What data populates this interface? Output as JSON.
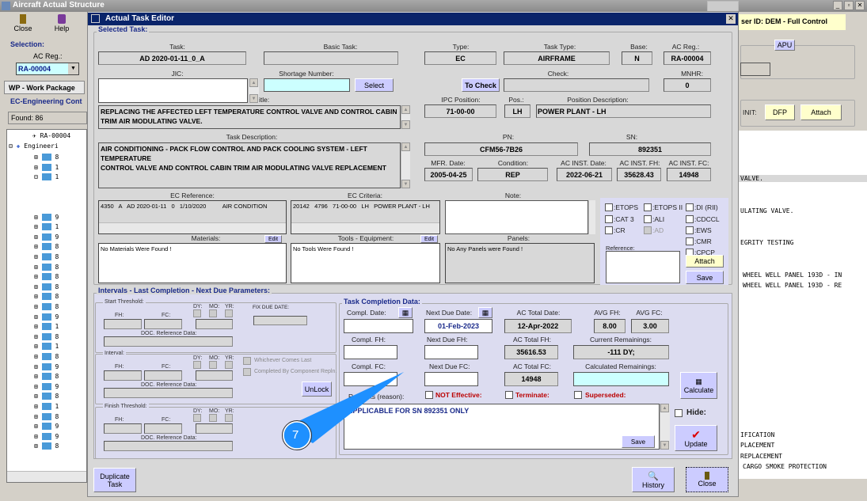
{
  "app": {
    "title": "Aircraft Actual Structure",
    "toolbar": {
      "close": "Close",
      "help": "Help"
    },
    "selection_label": "Selection:",
    "ac_reg_label": "AC Reg.:",
    "ac_reg_value": "RA-00004",
    "wp_tab": "WP - Work Package",
    "ec_section": "EC-Engineering Cont",
    "found": "Found: 86",
    "tree": {
      "root": "RA-00004",
      "engineering": "Engineeri",
      "items": [
        "8",
        "1",
        "1",
        "9",
        "1",
        "9",
        "8",
        "8",
        "8",
        "8",
        "8",
        "8",
        "8",
        "9",
        "1",
        "8",
        "1",
        "8",
        "9",
        "8",
        "9",
        "8",
        "1",
        "8",
        "9",
        "9",
        "8"
      ]
    },
    "user_id": "ser ID: DEM - Full Control",
    "apu": "APU",
    "init_label": "INIT:",
    "dfp": "DFP",
    "attach": "Attach",
    "right_lines": [
      "VALVE.",
      "ULATING VALVE.",
      "EGRITY TESTING",
      "WHEEL WELL PANEL 193D - IN",
      "WHEEL WELL PANEL 193D - RE",
      "IFICATION",
      "PLACEMENT",
      "REPLACEMENT",
      "CARGO SMOKE PROTECTION"
    ]
  },
  "dialog": {
    "title": "Actual Task Editor",
    "selected": {
      "section": "Selected Task:",
      "task_label": "Task:",
      "task": "AD 2020-01-11_0_A",
      "basic_task_label": "Basic Task:",
      "basic_task": "",
      "type_label": "Type:",
      "type": "EC",
      "task_type_label": "Task Type:",
      "task_type": "AIRFRAME",
      "base_label": "Base:",
      "base": "N",
      "ac_reg_label": "AC Reg.:",
      "ac_reg": "RA-00004",
      "jic_label": "JIC:",
      "shortage_label": "Shortage Number:",
      "select": "Select",
      "to_check": "To Check",
      "check_label": "Check:",
      "mnhr_label": "MNHR:",
      "mnhr": "0",
      "title_label": "itle:",
      "title": "REPLACING THE AFFECTED LEFT TEMPERATURE CONTROL VALVE AND CONTROL CABIN TRIM AIR MODULATING VALVE.",
      "ipc_label": "IPC Position:",
      "ipc": "71-00-00",
      "pos_label": "Pos.:",
      "pos": "LH",
      "posdesc_label": "Position Description:",
      "posdesc": "POWER PLANT - LH",
      "desc_label": "Task Description:",
      "desc": "AIR CONDITIONING - PACK FLOW CONTROL AND PACK COOLING SYSTEM - LEFT TEMPERATURE\nCONTROL VALVE AND CONTROL CABIN TRIM AIR MODULATING VALVE REPLACEMENT",
      "pn_label": "PN:",
      "pn": "CFM56-7B26",
      "sn_label": "SN:",
      "sn": "892351",
      "mfr_label": "MFR. Date:",
      "mfr": "2005-04-25",
      "cond_label": "Condition:",
      "cond": "REP",
      "inst_date_label": "AC INST. Date:",
      "inst_date": "2022-06-21",
      "inst_fh_label": "AC INST. FH:",
      "inst_fh": "35628.43",
      "inst_fc_label": "AC INST. FC:",
      "inst_fc": "14948",
      "ec_ref_label": "EC Reference:",
      "ec_ref": "4350   A   AD 2020-01-11   0   1/10/2020          AIR CONDITION",
      "ec_crit_label": "EC Criteria:",
      "ec_crit": "20142   4796   71-00-00   LH   POWER PLANT - LH",
      "note_label": "Note:",
      "materials_label": "Materials:",
      "materials": "No Materials Were Found !",
      "edit": "Edit",
      "tools_label": "Tools - Equipment:",
      "tools": "No Tools Were Found !",
      "panels_label": "Panels:",
      "panels": "No Any Panels were Found !",
      "flags": {
        "etops": ":ETOPS",
        "etops2": ":ETOPS II",
        "di": ":DI (RII)",
        "cat3": ":CAT 3",
        "ali": ":ALI",
        "cdccl": ":CDCCL",
        "cr": ":CR",
        "ad": ":AD",
        "ews": ":EWS",
        "cmr": ":CMR",
        "cpcp": ":CPCP"
      },
      "reference_label": "Reference:",
      "attach": "Attach",
      "save": "Save"
    },
    "intervals": {
      "section": "Intervals - Last Completion - Next Due Parameters:",
      "start": "Start Threshold:",
      "interval": "Interval:",
      "finish": "Finish Threshold:",
      "fh": "FH:",
      "fc": "FC:",
      "dy": "DY:",
      "mo": "MO:",
      "yr": "YR:",
      "doc": "DOC. Reference Data:",
      "fix_due": "FIX DUE DATE:",
      "whichever": "Whichever Comes Last",
      "completed_by": "Completed By Component Repln.",
      "unlock": "UnLock"
    },
    "completion": {
      "section": "Task Completion Data:",
      "compl_date_label": "Compl. Date:",
      "next_due_date_label": "Next Due Date:",
      "next_due_date": "01-Feb-2023",
      "ac_total_date_label": "AC Total Date:",
      "ac_total_date": "12-Apr-2022",
      "avg_fh_label": "AVG FH:",
      "avg_fh": "8.00",
      "avg_fc_label": "AVG FC:",
      "avg_fc": "3.00",
      "compl_fh_label": "Compl. FH:",
      "next_due_fh_label": "Next Due FH:",
      "ac_total_fh_label": "AC Total FH:",
      "ac_total_fh": "35616.53",
      "current_rem_label": "Current Remainings:",
      "current_rem": "-111 DY;",
      "compl_fc_label": "Compl. FC:",
      "next_due_fc_label": "Next Due FC:",
      "ac_total_fc_label": "AC Total FC:",
      "ac_total_fc": "14948",
      "calc_rem_label": "Calculated Remainings:",
      "calculate": "Calculate",
      "remarks_label": "Remarks (reason):",
      "not_effective": "NOT Effective:",
      "terminate": "Terminate:",
      "superseded": "Superseded:",
      "remarks": "APPLICABLE FOR SN 892351 ONLY",
      "save": "Save",
      "hide": "Hide:",
      "update": "Update"
    },
    "footer": {
      "duplicate": "Duplicate Task",
      "history": "History",
      "close": "Close"
    }
  },
  "callout": {
    "number": "7",
    "color": "#1e90ff"
  }
}
